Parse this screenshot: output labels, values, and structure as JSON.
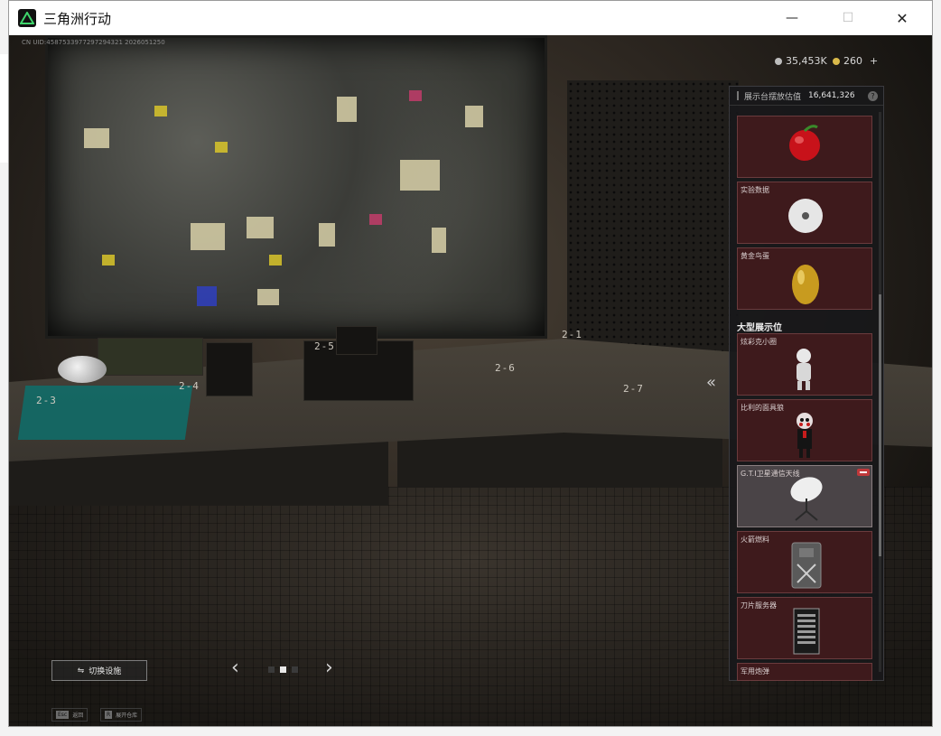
{
  "window": {
    "title": "三角洲行动",
    "minimize_glyph": "—",
    "maximize_glyph": "☐",
    "close_glyph": "✕"
  },
  "hud": {
    "uid": "CN UID:4587533977297294321 2026051250",
    "currency_1": "35,453K",
    "currency_2": "260",
    "currency_2_add": "+"
  },
  "scene": {
    "slot_labels": [
      "2-3",
      "2-4",
      "2-5",
      "2-6",
      "2-7",
      "2-1"
    ]
  },
  "panel": {
    "header_label": "展示台摆放估值",
    "header_value": "16,641,326",
    "help": "?",
    "section_large": "大型展示位",
    "cards": [
      {
        "label": "",
        "icon": "apple-icon"
      },
      {
        "label": "实验数据",
        "icon": "disc-icon"
      },
      {
        "label": "黄金鸟蛋",
        "icon": "golden-egg-icon"
      },
      {
        "label": "炫彩克小圈",
        "icon": "figurine-icon"
      },
      {
        "label": "比利的面具狼",
        "icon": "puppet-icon"
      },
      {
        "label": "G.T.I卫星通信天线",
        "icon": "satellite-dish-icon",
        "selected": true
      },
      {
        "label": "火箭燃料",
        "icon": "fuel-canister-icon"
      },
      {
        "label": "刀片服务器",
        "icon": "blade-server-icon"
      },
      {
        "label": "军用炮弹",
        "icon": "shell-icon"
      }
    ],
    "collapse_glyph": "«"
  },
  "footer": {
    "switch_label": "切换设施",
    "prev_glyph": "‹",
    "next_glyph": "›",
    "hint_1_key": "Esc",
    "hint_1_label": "返回",
    "hint_2_key": "R",
    "hint_2_label": "展开仓库"
  },
  "colors": {
    "card_bg": "#3e1a1c",
    "card_selected_bg": "#4a4447",
    "remove_badge": "#c0393b",
    "mat": "#0e6f6b"
  }
}
